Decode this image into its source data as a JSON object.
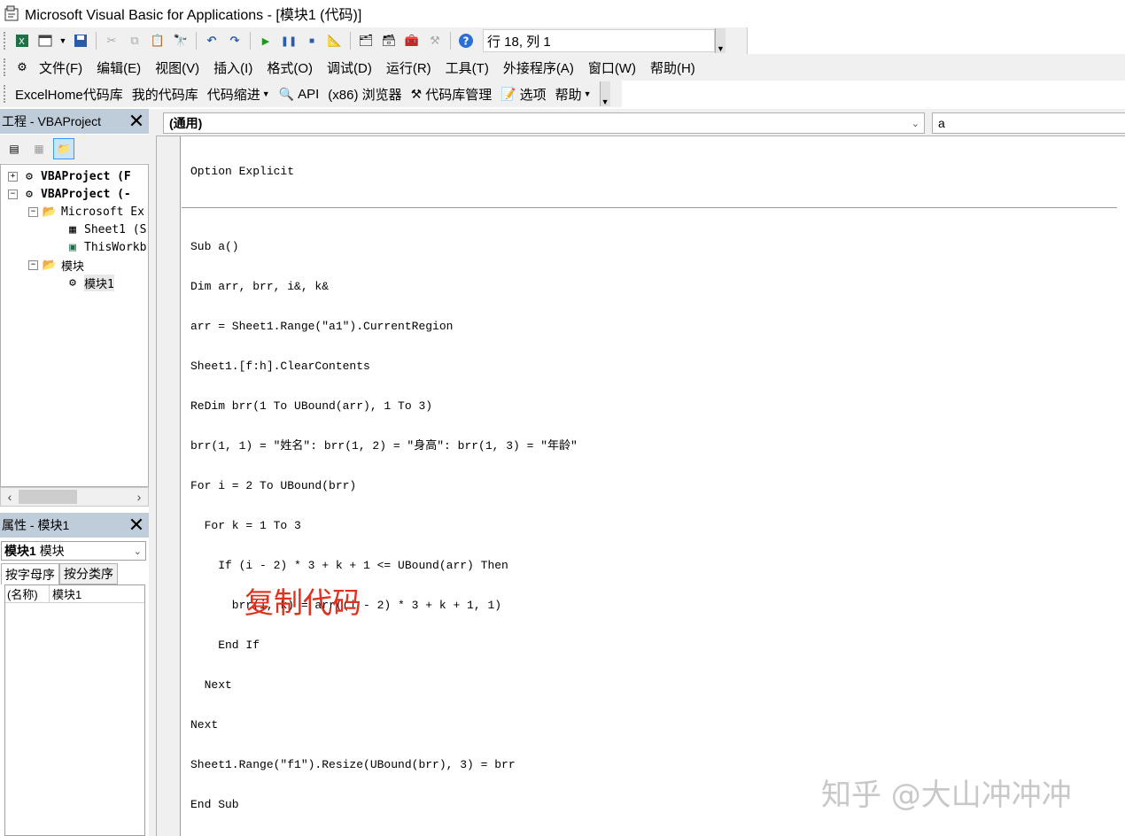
{
  "window": {
    "title": "Microsoft Visual Basic for Applications - [模块1 (代码)]"
  },
  "toolbar_standard": {
    "cursor_position": "行 18, 列 1"
  },
  "menu": [
    "文件(F)",
    "编辑(E)",
    "视图(V)",
    "插入(I)",
    "格式(O)",
    "调试(D)",
    "运行(R)",
    "工具(T)",
    "外接程序(A)",
    "窗口(W)",
    "帮助(H)"
  ],
  "toolbar_addin": {
    "code_lib": "ExcelHome代码库",
    "my_lib": "我的代码库",
    "indent": "代码缩进",
    "api": "API",
    "browser": "(x86) 浏览器",
    "manage": "代码库管理",
    "options": "选项",
    "help": "帮助"
  },
  "project_explorer": {
    "title": "工程 - VBAProject",
    "tree": [
      {
        "label": "VBAProject (F",
        "level": 0,
        "expander": "+",
        "bold": true
      },
      {
        "label": "VBAProject (-",
        "level": 0,
        "expander": "-",
        "bold": true
      },
      {
        "label": "Microsoft Ex",
        "level": 1,
        "expander": "-",
        "bold": false
      },
      {
        "label": "Sheet1 (S",
        "level": 2,
        "expander": "",
        "bold": false
      },
      {
        "label": "ThisWorkb",
        "level": 2,
        "expander": "",
        "bold": false
      },
      {
        "label": "模块",
        "level": 1,
        "expander": "-",
        "bold": false
      },
      {
        "label": "模块1",
        "level": 2,
        "expander": "",
        "bold": false
      }
    ]
  },
  "properties": {
    "title": "属性 - 模块1",
    "object_name": "模块1",
    "object_type": "模块",
    "tabs": [
      "按字母序",
      "按分类序"
    ],
    "rows": [
      {
        "key": "(名称)",
        "value": "模块1"
      }
    ]
  },
  "code_window": {
    "object_combo": "(通用)",
    "procedure_combo": "a",
    "header_line": "Option Explicit",
    "lines": [
      "Sub a()",
      "Dim arr, brr, i&, k&",
      "arr = Sheet1.Range(\"a1\").CurrentRegion",
      "Sheet1.[f:h].ClearContents",
      "ReDim brr(1 To UBound(arr), 1 To 3)",
      "brr(1, 1) = \"姓名\": brr(1, 2) = \"身高\": brr(1, 3) = \"年龄\"",
      "For i = 2 To UBound(brr)",
      "  For k = 1 To 3",
      "    If (i - 2) * 3 + k + 1 <= UBound(arr) Then",
      "      brr(i, k) = arr((i - 2) * 3 + k + 1, 1)",
      "    End If",
      "  Next",
      "Next",
      "Sheet1.Range(\"f1\").Resize(UBound(brr), 3) = brr",
      "End Sub"
    ]
  },
  "annotation": "复制代码",
  "watermark": "知乎 @大山冲冲冲",
  "colors": {
    "annotation": "#e0301e",
    "panel_title": "#bfcddb",
    "toolbar": "#f0f0f0"
  }
}
